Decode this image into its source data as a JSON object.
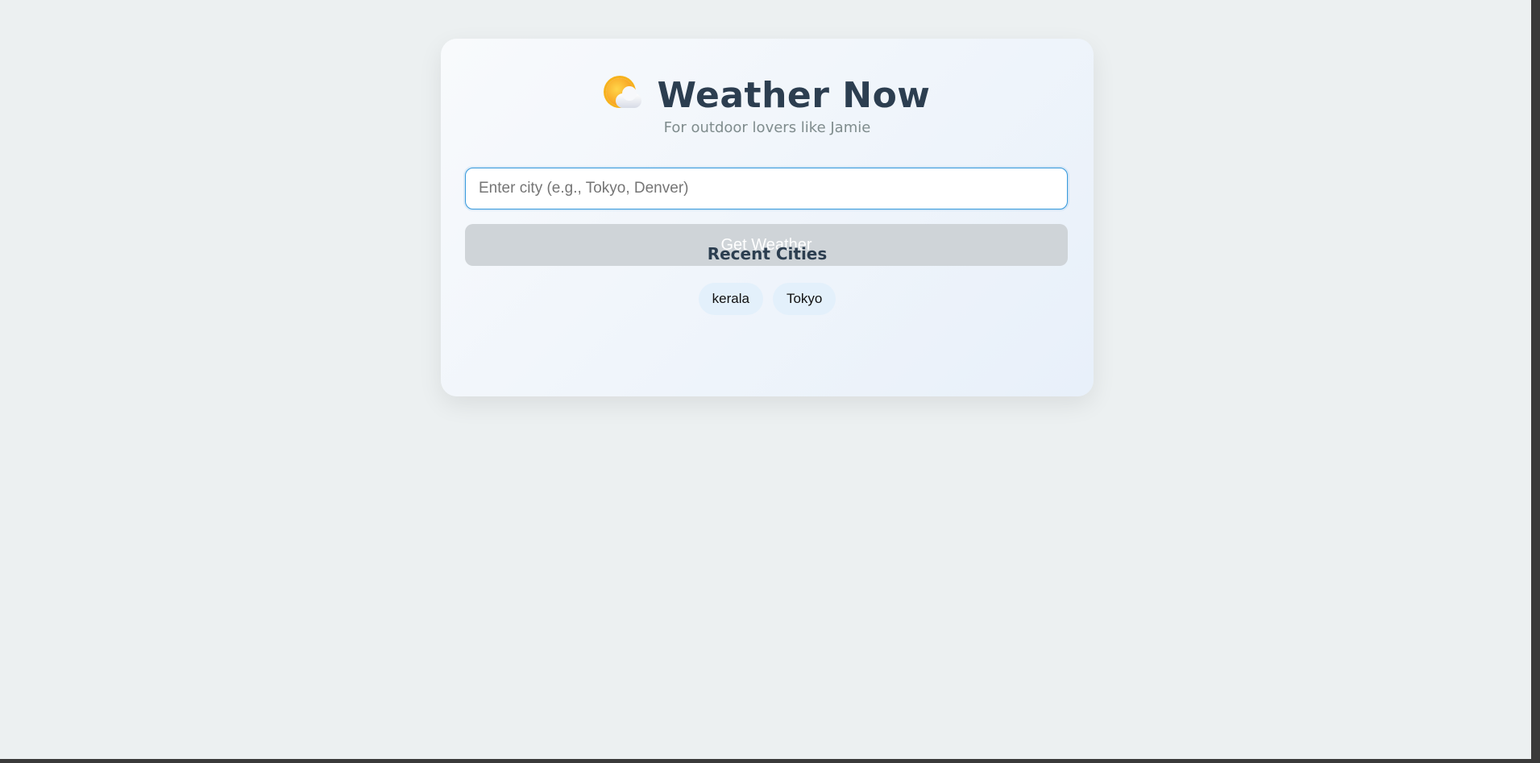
{
  "header": {
    "icon": "sun-behind-cloud-icon",
    "title": "Weather Now",
    "subtitle": "For outdoor lovers like Jamie"
  },
  "search": {
    "placeholder": "Enter city (e.g., Tokyo, Denver)",
    "value": "",
    "button_label": "Get Weather",
    "button_disabled": true
  },
  "recent": {
    "heading": "Recent Cities",
    "cities": [
      "kerala",
      "Tokyo"
    ]
  },
  "colors": {
    "page_background": "#ecf0f1",
    "title": "#2c3e50",
    "input_border": "#3498db",
    "button_disabled": "#cfd4d8",
    "chip_background": "#e3f0fb"
  }
}
